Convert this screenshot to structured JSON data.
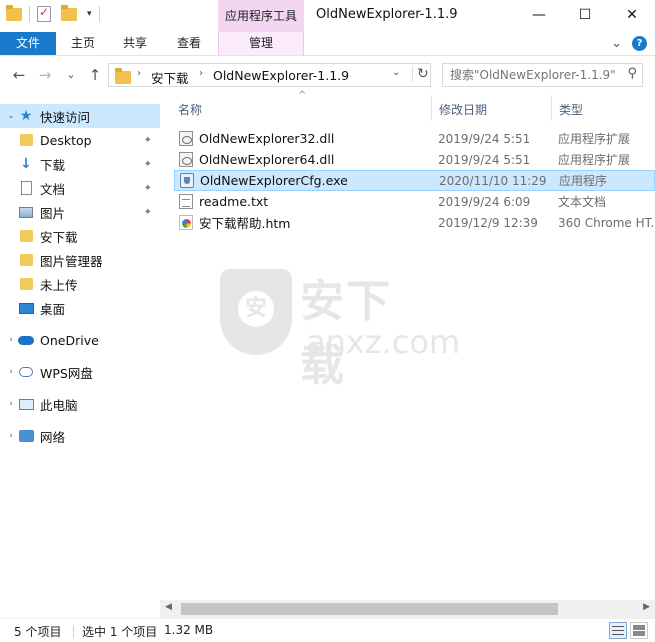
{
  "titlebar": {
    "contextual_tab": "应用程序工具",
    "title": "OldNewExplorer-1.1.9",
    "minimize": "—",
    "maximize": "☐",
    "close": "✕"
  },
  "ribbon": {
    "tabs": [
      {
        "label": "文件"
      },
      {
        "label": "主页"
      },
      {
        "label": "共享"
      },
      {
        "label": "查看"
      },
      {
        "label": "管理"
      }
    ],
    "expand_glyph": "⌄",
    "help": "?"
  },
  "address": {
    "back": "←",
    "forward": "→",
    "recent": "⌄",
    "up": "↑",
    "crumbs": [
      "安下载",
      "OldNewExplorer-1.1.9"
    ],
    "crumb_sep": "›",
    "dropdown": "⌄",
    "refresh": "↻"
  },
  "search": {
    "placeholder": "搜索\"OldNewExplorer-1.1.9\"",
    "icon": "⚲"
  },
  "nav": {
    "items": [
      {
        "label": "快速访问",
        "icon": "star-icon",
        "expand": "⌄"
      },
      {
        "label": "Desktop",
        "icon": "folder-icon",
        "pinned": true
      },
      {
        "label": "下载",
        "icon": "download-icon",
        "pinned": true
      },
      {
        "label": "文档",
        "icon": "document-icon",
        "pinned": true
      },
      {
        "label": "图片",
        "icon": "pictures-icon",
        "pinned": true
      },
      {
        "label": "安下载",
        "icon": "folder-icon",
        "pinned": false
      },
      {
        "label": "图片管理器",
        "icon": "folder-icon",
        "pinned": false
      },
      {
        "label": "未上传",
        "icon": "folder-icon",
        "pinned": false
      },
      {
        "label": "桌面",
        "icon": "desktop-icon",
        "pinned": false
      },
      {
        "label": "OneDrive",
        "icon": "cloud-icon",
        "expand": "›"
      },
      {
        "label": "WPS网盘",
        "icon": "wps-cloud-icon",
        "expand": "›"
      },
      {
        "label": "此电脑",
        "icon": "computer-icon",
        "expand": "›"
      },
      {
        "label": "网络",
        "icon": "network-icon",
        "expand": "›"
      }
    ],
    "pin_glyph": "📌"
  },
  "columns": {
    "name": "名称",
    "date": "修改日期",
    "type": "类型",
    "sort_glyph": "^"
  },
  "files": [
    {
      "name": "OldNewExplorer32.dll",
      "date": "2019/9/24 5:51",
      "type": "应用程序扩展",
      "icon": "dll-icon"
    },
    {
      "name": "OldNewExplorer64.dll",
      "date": "2019/9/24 5:51",
      "type": "应用程序扩展",
      "icon": "dll-icon"
    },
    {
      "name": "OldNewExplorerCfg.exe",
      "date": "2020/11/10 11:29",
      "type": "应用程序",
      "icon": "exe-icon",
      "selected": true
    },
    {
      "name": "readme.txt",
      "date": "2019/9/24 6:09",
      "type": "文本文档",
      "icon": "text-file-icon"
    },
    {
      "name": "安下载帮助.htm",
      "date": "2019/12/9 12:39",
      "type": "360 Chrome HT...",
      "icon": "html-file-icon"
    }
  ],
  "watermark": {
    "shield_char": "安",
    "text": "安下载",
    "sub": "anxz.com"
  },
  "scrollbar": {
    "left": "◀",
    "right": "▶"
  },
  "status": {
    "count": "5 个项目",
    "selected": "选中 1 个项目",
    "size": "1.32 MB"
  }
}
